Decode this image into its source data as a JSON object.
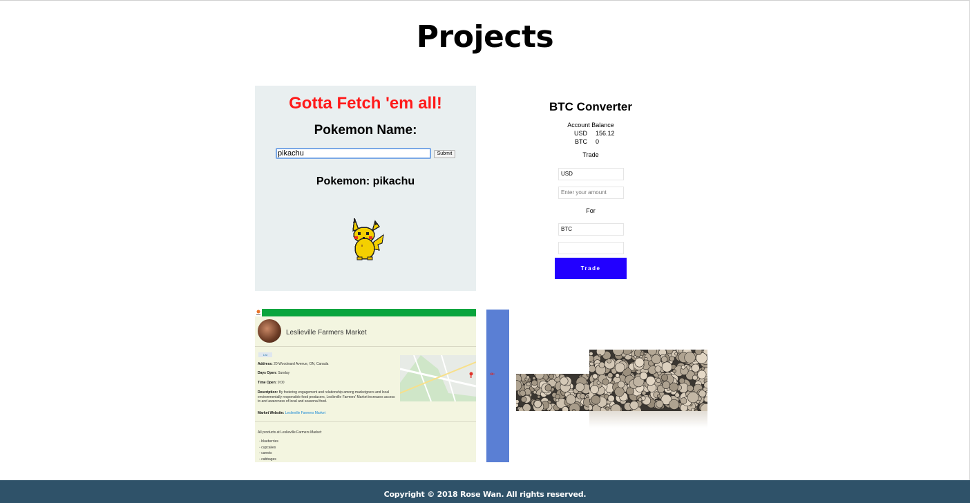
{
  "page": {
    "title": "Projects"
  },
  "pokemon_card": {
    "heading": "Gotta Fetch 'em all!",
    "name_label": "Pokemon Name:",
    "input_value": "pikachu",
    "submit_label": "Submit",
    "result": "Pokemon: pikachu",
    "heading_color": "#ff1a1a",
    "sprite": "pikachu-sprite"
  },
  "btc_card": {
    "title": "BTC Converter",
    "balance_label": "Account Balance",
    "usd_label": "USD",
    "usd_value": "156.12",
    "btc_label": "BTC",
    "btc_value": "0",
    "trade_label": "Trade",
    "from_currency": "USD",
    "amount_placeholder": "Enter your amount",
    "for_label": "For",
    "to_currency": "BTC",
    "result_value": "",
    "trade_button": "Trade",
    "button_color": "#2200ff"
  },
  "market_card": {
    "title": "Leslieville Farmers Market",
    "list_button": "List",
    "address_label": "Address:",
    "address": "20 Woodward Avenue, ON, Canada",
    "days_label": "Days Open:",
    "days": "Sunday",
    "time_label": "Time Open:",
    "time": "9:00",
    "description_label": "Description:",
    "description": "By fostering engagement and relationship among marketgoers and local environmentally responsible food producers, Leslieville Farmers' Market increases access to and awareness of local and seasonal food.",
    "website_label": "Market Website:",
    "website": "Leslieville Farmers Market",
    "products_heading": "All products at Leslieville Farmers Market:",
    "products": [
      "blueberries",
      "cupcakes",
      "carrots",
      "cabbages"
    ],
    "bar_color": "#0aa53e"
  },
  "slider_card": {
    "color": "#5a7fd4",
    "arrow": "↞"
  },
  "footer": {
    "text": "Copyright © 2018 Rose Wan. All rights reserved.",
    "color": "#2f5269"
  }
}
